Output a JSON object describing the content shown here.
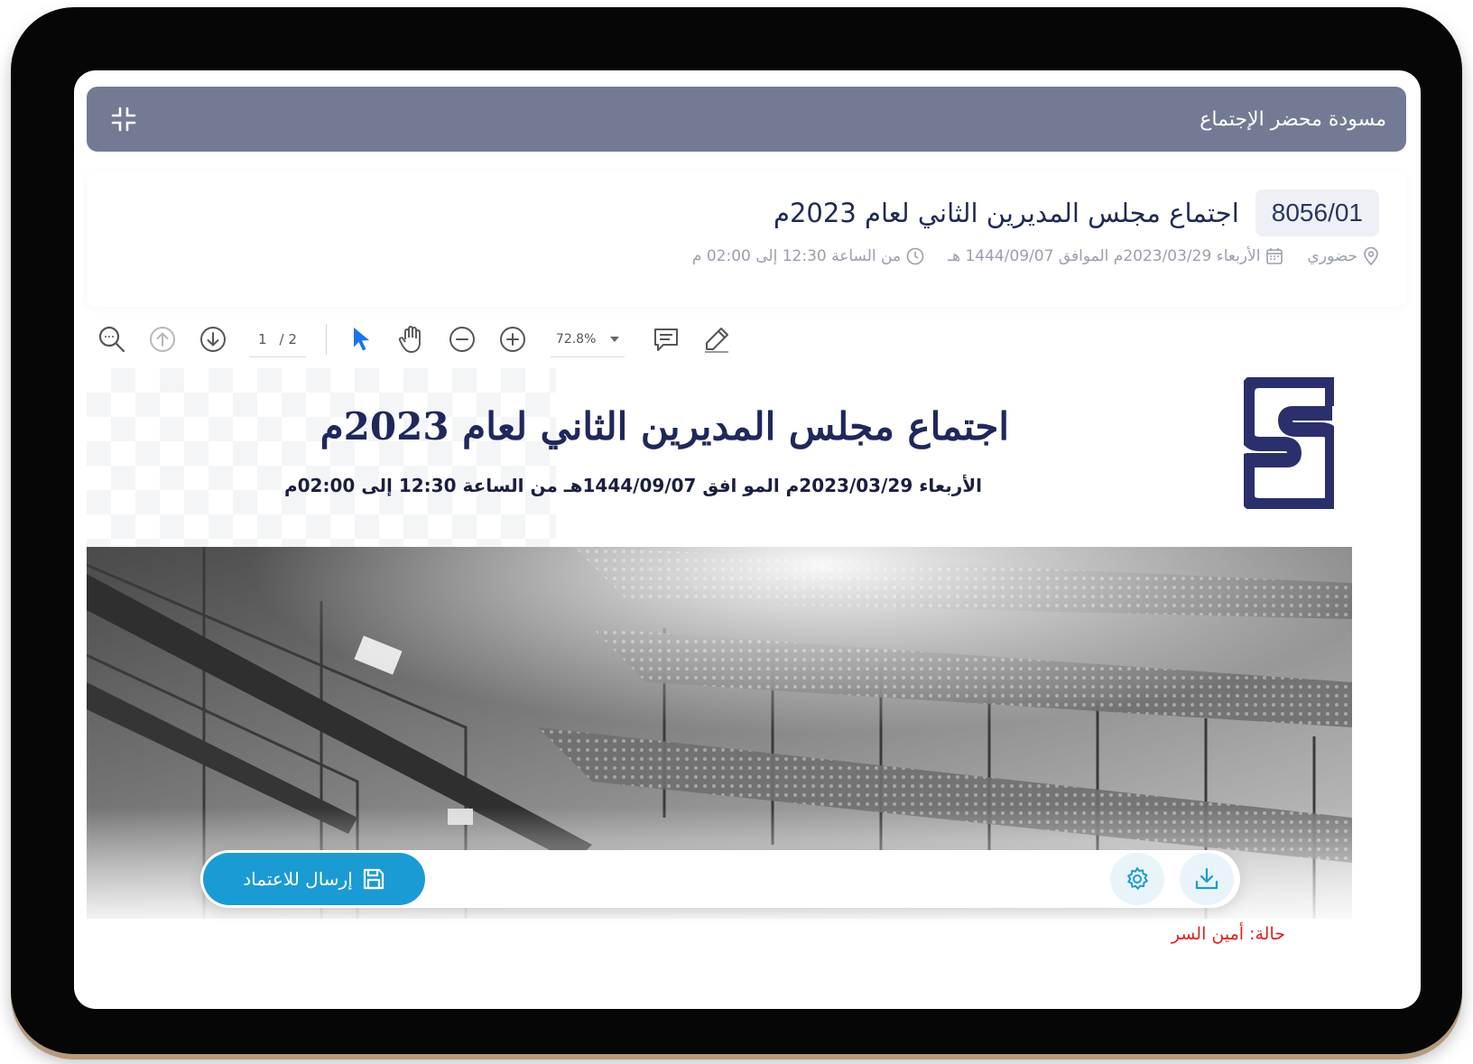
{
  "modal": {
    "title": "مسودة محضر الإجتماع"
  },
  "meeting": {
    "code": "8056/01",
    "title": "اجتماع مجلس المديرين الثاني لعام 2023م",
    "type": "حضوري",
    "date": "الأربعاء 2023/03/29م الموافق 1444/09/07 هـ",
    "time": "من الساعة 12:30 إلى 02:00 م"
  },
  "pdf_toolbar": {
    "current_page": "1",
    "total_pages": "/ 2",
    "zoom": "72.8%"
  },
  "document": {
    "title": "اجتماع مجلس المديرين الثاني لعام 2023م",
    "subtitle": "الأربعاء 2023/03/29م المو افق 1444/09/07هـ من الساعة 12:30 إلى 02:00م"
  },
  "actions": {
    "submit_label": "إرسال للاعتماد"
  },
  "status": {
    "text": "حالة: أمين السر"
  },
  "colors": {
    "header_bg": "#737b94",
    "brand_navy": "#2b2f6b",
    "submit_bg": "#1b9bd3",
    "status_red": "#e02020",
    "select_tool_blue": "#1a73e8"
  },
  "icons": {
    "collapse": "collapse-icon",
    "location": "location-pin-icon",
    "calendar": "calendar-icon",
    "clock": "clock-icon",
    "search": "zoom-search-icon",
    "prev_page": "arrow-up-circle-icon",
    "next_page": "arrow-down-circle-icon",
    "select": "cursor-icon",
    "hand": "hand-icon",
    "zoom_out": "minus-circle-icon",
    "zoom_in": "plus-circle-icon",
    "comment": "comment-icon",
    "draw": "pen-icon",
    "save": "save-icon",
    "settings": "gear-icon",
    "download": "download-icon"
  }
}
